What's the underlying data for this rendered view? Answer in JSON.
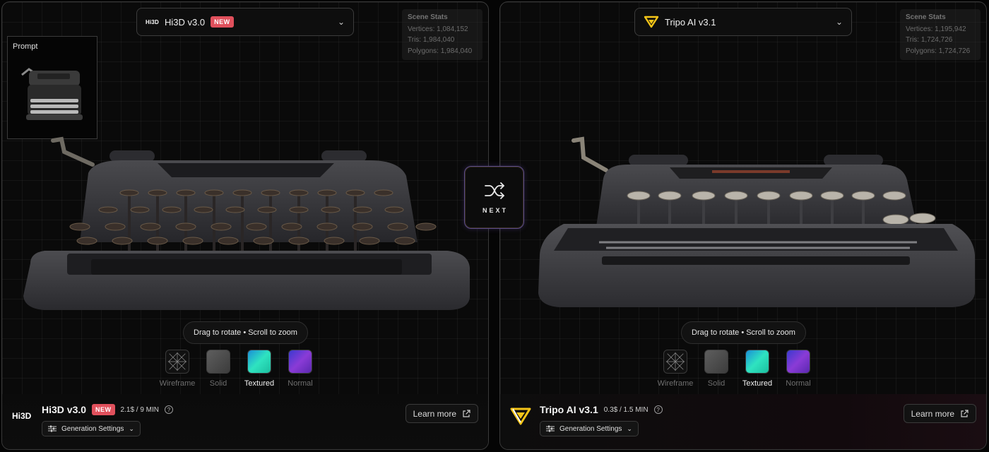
{
  "compare": {
    "next_label": "NEXT",
    "interaction_hint": "Drag to rotate • Scroll to zoom",
    "render_modes": [
      "Wireframe",
      "Solid",
      "Textured",
      "Normal"
    ],
    "active_mode": "Textured"
  },
  "left": {
    "logo_text": "Hi3D",
    "model_name": "Hi3D v3.0",
    "badge": "NEW",
    "stats": {
      "title": "Scene Stats",
      "vertices": "Vertices: 1,084,152",
      "tris": "Tris: 1,984,040",
      "polygons": "Polygons: 1,984,040"
    },
    "prompt_label": "Prompt",
    "footer": {
      "name": "Hi3D v3.0",
      "badge": "NEW",
      "price": "2.1$ / 9 MIN",
      "generation_settings": "Generation Settings",
      "learn_more": "Learn more"
    }
  },
  "right": {
    "model_name": "Tripo AI v3.1",
    "stats": {
      "title": "Scene Stats",
      "vertices": "Vertices: 1,195,942",
      "tris": "Tris: 1,724,726",
      "polygons": "Polygons: 1,724,726"
    },
    "footer": {
      "name": "Tripo AI v3.1",
      "price": "0.3$ / 1.5 MIN",
      "generation_settings": "Generation Settings",
      "learn_more": "Learn more"
    }
  },
  "colors": {
    "badge_new": "#e0505c",
    "tripo_yellow": "#f5c518",
    "textured_swatch": "#2fe3c0",
    "normal_swatch": "#8a3bd6"
  }
}
